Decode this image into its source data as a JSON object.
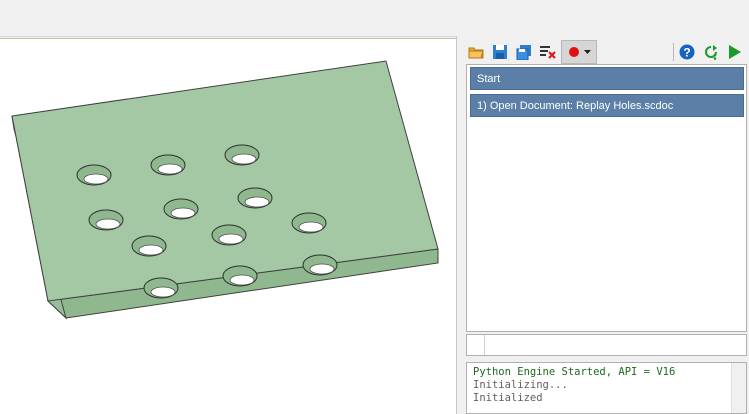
{
  "journal": {
    "rows": [
      {
        "label": "Start"
      },
      {
        "label": "1) Open Document: Replay Holes.scdoc"
      }
    ]
  },
  "console": {
    "lines": [
      "Python Engine Started, API = V16",
      "Initializing...",
      "Initialized"
    ]
  },
  "toolbar": {
    "icons": [
      "open-folder-icon",
      "save-icon",
      "save-as-icon",
      "clear-journal-icon",
      "record-icon",
      "help-icon",
      "step-icon",
      "run-icon"
    ]
  },
  "colors": {
    "part_face": "#a3c8a3",
    "part_side": "#8fb88f",
    "journal_row": "#5b7fa6",
    "record": "#e01010",
    "run": "#1a9a2a",
    "help": "#1565c0"
  }
}
